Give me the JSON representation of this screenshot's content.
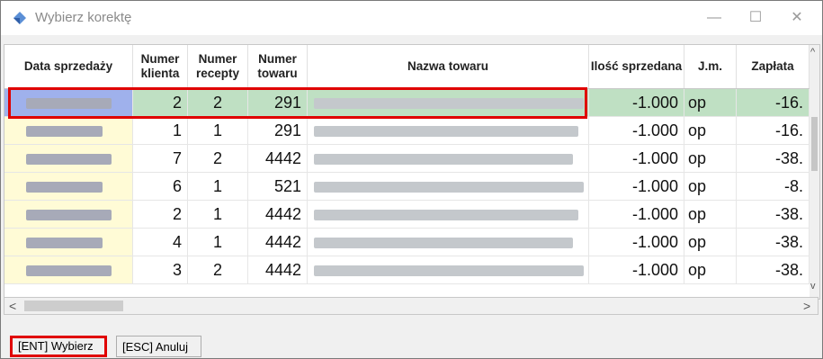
{
  "window": {
    "title": "Wybierz korektę",
    "minimize": "—",
    "maximize": "☐",
    "close": "✕"
  },
  "table": {
    "columns": [
      "Data sprzedaży",
      "Numer klienta",
      "Numer recepty",
      "Numer towaru",
      "Nazwa towaru",
      "Ilość sprzedana",
      "J.m.",
      "Zapłata"
    ],
    "rows": [
      {
        "klient": "2",
        "recepta": "2",
        "towar": "291",
        "ilosc": "-1.000",
        "jm": "op",
        "zaplata": "-16."
      },
      {
        "klient": "1",
        "recepta": "1",
        "towar": "291",
        "ilosc": "-1.000",
        "jm": "op",
        "zaplata": "-16."
      },
      {
        "klient": "7",
        "recepta": "2",
        "towar": "4442",
        "ilosc": "-1.000",
        "jm": "op",
        "zaplata": "-38."
      },
      {
        "klient": "6",
        "recepta": "1",
        "towar": "521",
        "ilosc": "-1.000",
        "jm": "op",
        "zaplata": "-8."
      },
      {
        "klient": "2",
        "recepta": "1",
        "towar": "4442",
        "ilosc": "-1.000",
        "jm": "op",
        "zaplata": "-38."
      },
      {
        "klient": "4",
        "recepta": "1",
        "towar": "4442",
        "ilosc": "-1.000",
        "jm": "op",
        "zaplata": "-38."
      },
      {
        "klient": "3",
        "recepta": "2",
        "towar": "4442",
        "ilosc": "-1.000",
        "jm": "op",
        "zaplata": "-38."
      }
    ]
  },
  "scroll": {
    "left_arrow": "<",
    "right_arrow": ">",
    "up_arrow": "^",
    "down_arrow": "v"
  },
  "buttons": {
    "select": "[ENT] Wybierz",
    "cancel": "[ESC] Anuluj"
  },
  "colors": {
    "selected_row": "#bfe0c3",
    "selected_date": "#9fb1ec",
    "date_cell": "#fffbd6",
    "highlight": "#e00000"
  }
}
